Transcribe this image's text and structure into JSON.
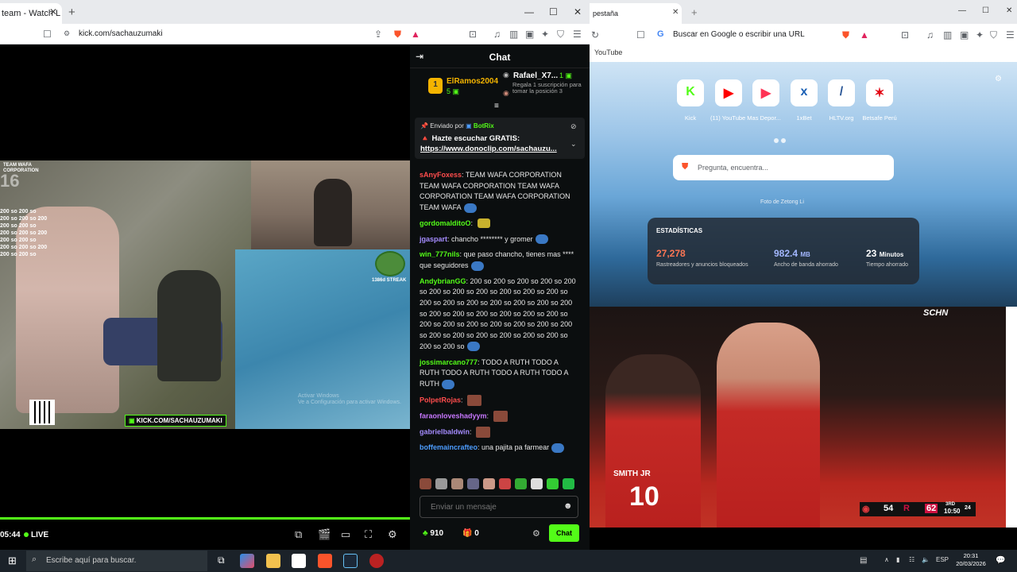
{
  "left_browser": {
    "tab_title": "team - Watch L",
    "url": "kick.com/sachauzumaki"
  },
  "stream": {
    "overlay_team": "TEAM WAFA\nCORPORATION",
    "overlay_number": "16",
    "overlay_lines": [
      "200 so 200 so",
      "200 so 200 so 200",
      "200 so 200 so",
      "200 so 200 so 200",
      "200 so 200 so",
      "200 so 200 so 200",
      "200 so 200 so"
    ],
    "kick_banner": "KICK.COM/SACHAUZUMAKI",
    "streak": "1386d STREAK",
    "watermark": "Activar Windows\nVe a Configuración para activar Windows.",
    "time": "05:44",
    "live": "LIVE"
  },
  "chat": {
    "title": "Chat",
    "leaderboard": {
      "first_name": "ElRamos2004",
      "first_rank": "1",
      "first_count": "5",
      "second_name": "Rafael_X7...",
      "second_count": "1",
      "gift_note": "Regala 1 suscripción para tomar la posición 3"
    },
    "pinned": {
      "sent_by": "Enviado por",
      "bot": "BotRix",
      "text": "Hazte escuchar GRATIS:",
      "link": "https://www.donoclip.com/sachauzu..."
    },
    "messages": [
      {
        "user": "sAnyFoxess",
        "color": "#ff4d4d",
        "text": "TEAM WAFA CORPORATION TEAM WAFA CORPORATION TEAM WAFA CORPORATION TEAM WAFA CORPORATION TEAM WAFA"
      },
      {
        "user": "gordomalditoO",
        "color": "#53fc18",
        "text": ""
      },
      {
        "user": "jgaspart",
        "color": "#a58cff",
        "text": "chancho ******** y gromer"
      },
      {
        "user": "win_777nils",
        "color": "#53fc18",
        "text": "que paso chancho, tienes mas **** que seguidores"
      },
      {
        "user": "AndybrianGG",
        "color": "#53fc18",
        "text": "200 so 200 so 200 so 200 so 200 so 200 so 200 so 200 so 200 so 200 so 200 so 200 so 200 so 200 so 200 so 200 so 200 so 200 so 200 so 200 so 200 so 200 so 200 so 200 so 200 so 200 so 200 so 200 so 200 so 200 so 200 so 200 so 200 so 200 so 200 so 200 so 200 so 200 so 200 so"
      },
      {
        "user": "jossimarcano777",
        "color": "#53fc18",
        "text": "TODO A RUTH TODO A RUTH TODO A RUTH TODO A RUTH TODO A RUTH"
      },
      {
        "user": "PolpetRojas",
        "color": "#ff4d4d",
        "text": ""
      },
      {
        "user": "faraonloveshadyym",
        "color": "#c878ff",
        "text": ""
      },
      {
        "user": "gabrielbaldwin",
        "color": "#a58cff",
        "text": ""
      },
      {
        "user": "boffemaincrafteo",
        "color": "#4d9dff",
        "text": "una pajita pa farmear"
      }
    ],
    "input_placeholder": "Enviar un mensaje",
    "points": "910",
    "gifts": "0",
    "send_label": "Chat"
  },
  "right_browser": {
    "tab_title": "pestaña",
    "address_placeholder": "Buscar en Google o escribir una URL",
    "bookmark": "YouTube",
    "tiles": [
      {
        "label": "Kick",
        "icon": "K",
        "color": "#53fc18"
      },
      {
        "label": "(11) YouTube Mas Depor...",
        "icon": "▶",
        "color": "#ff0000"
      },
      {
        "label": "",
        "icon": "▶",
        "color": "#ff3355"
      },
      {
        "label": "1xBet",
        "icon": "x",
        "color": "#1a5fb4"
      },
      {
        "label": "HLTV.org",
        "icon": "/",
        "color": "#2b5797"
      },
      {
        "label": "Betsafe Perú",
        "icon": "✶",
        "color": "#e30613"
      }
    ],
    "search_placeholder": "Pregunta, encuentra...",
    "photo_credit": "Foto de Zetong Li",
    "stats": {
      "title": "ESTADÍSTICAS",
      "blocked_value": "27,278",
      "blocked_label": "Rastreadores y anuncios bloqueados",
      "bandwidth_value": "982.4",
      "bandwidth_unit": "MB",
      "bandwidth_label": "Ancho de banda ahorrado",
      "time_value": "23",
      "time_unit": "Minutos",
      "time_label": "Tiempo ahorrado"
    }
  },
  "basketball": {
    "network": "SCHN",
    "jersey": "10",
    "jersey_name": "SMITH JR",
    "score_away": "54",
    "score_home": "62",
    "quarter": "3RD",
    "clock": "10:50",
    "shot": "24"
  },
  "taskbar": {
    "search_placeholder": "Escribe aquí para buscar.",
    "lang": "ESP",
    "time": "20:31",
    "date": "20/03/2026"
  }
}
